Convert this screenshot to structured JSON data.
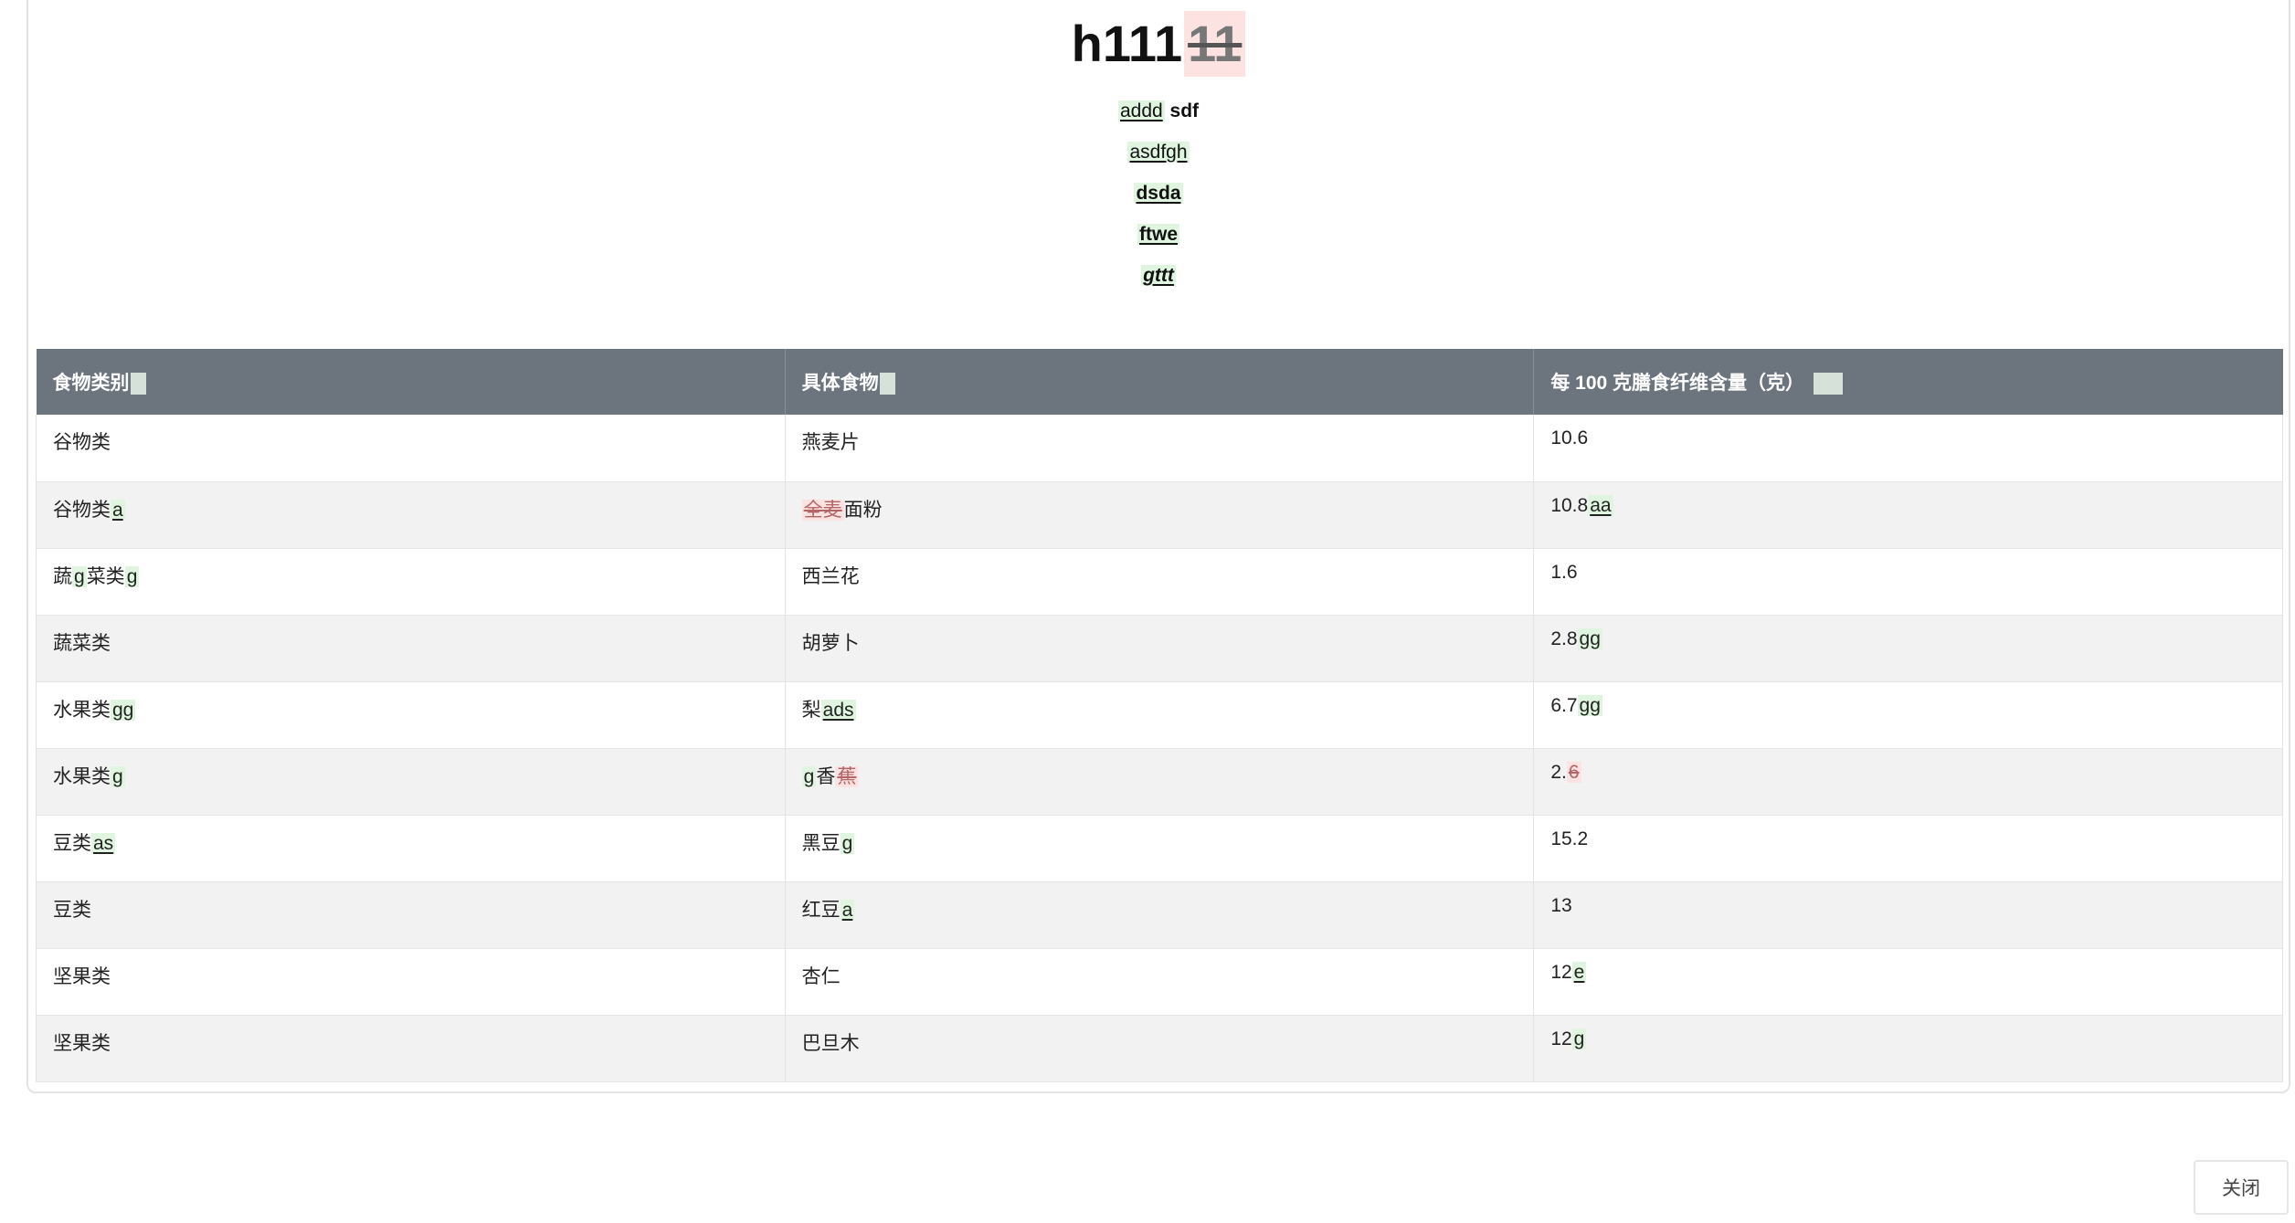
{
  "document": {
    "title": {
      "text": "h111",
      "deleted": "11"
    },
    "lines": [
      [
        {
          "text": "addd",
          "style": "ins"
        },
        {
          "text": " "
        },
        {
          "text": "sdf",
          "style": "bold"
        }
      ],
      [
        {
          "text": "asdfgh",
          "style": "ins"
        }
      ],
      [
        {
          "text": "dsda",
          "style": "ins-bold"
        }
      ],
      [
        {
          "text": "ftwe",
          "style": "ins-bold"
        }
      ],
      [
        {
          "text": "gttt",
          "style": "ins-bold-italic"
        }
      ]
    ]
  },
  "table": {
    "headers": [
      {
        "label": "食物类别",
        "marker": "ins"
      },
      {
        "label": "具体食物",
        "marker": "ins"
      },
      {
        "label": "每 100 克膳食纤维含量（克）",
        "marker": "ins-wide"
      }
    ],
    "rows": [
      [
        [
          {
            "text": "谷物类"
          }
        ],
        [
          {
            "text": "燕麦片"
          }
        ],
        [
          {
            "text": "10.6"
          }
        ]
      ],
      [
        [
          {
            "text": "谷物类"
          },
          {
            "text": "a",
            "style": "ins"
          }
        ],
        [
          {
            "text": "全麦",
            "style": "del"
          },
          {
            "text": "面粉"
          }
        ],
        [
          {
            "text": "10.8"
          },
          {
            "text": "aa",
            "style": "ins"
          }
        ]
      ],
      [
        [
          {
            "text": "蔬"
          },
          {
            "text": "g",
            "style": "ins-plain"
          },
          {
            "text": "菜类"
          },
          {
            "text": "g",
            "style": "ins-plain"
          }
        ],
        [
          {
            "text": "西兰花"
          }
        ],
        [
          {
            "text": "1.6"
          }
        ]
      ],
      [
        [
          {
            "text": "蔬菜类"
          }
        ],
        [
          {
            "text": "胡萝卜"
          }
        ],
        [
          {
            "text": "2.8"
          },
          {
            "text": "gg",
            "style": "ins-plain"
          }
        ]
      ],
      [
        [
          {
            "text": "水果类"
          },
          {
            "text": "gg",
            "style": "ins-plain"
          }
        ],
        [
          {
            "text": "梨"
          },
          {
            "text": "ads",
            "style": "ins"
          }
        ],
        [
          {
            "text": "6.7"
          },
          {
            "text": "gg",
            "style": "ins-plain"
          }
        ]
      ],
      [
        [
          {
            "text": "水果类"
          },
          {
            "text": "g",
            "style": "ins-plain"
          }
        ],
        [
          {
            "text": "g",
            "style": "ins-plain"
          },
          {
            "text": "香"
          },
          {
            "text": "蕉",
            "style": "del"
          }
        ],
        [
          {
            "text": "2."
          },
          {
            "text": "6",
            "style": "del"
          }
        ]
      ],
      [
        [
          {
            "text": "豆类"
          },
          {
            "text": "as",
            "style": "ins"
          }
        ],
        [
          {
            "text": "黑豆"
          },
          {
            "text": "g",
            "style": "ins-plain"
          }
        ],
        [
          {
            "text": "15.2"
          }
        ]
      ],
      [
        [
          {
            "text": "豆类"
          }
        ],
        [
          {
            "text": "红豆"
          },
          {
            "text": "a",
            "style": "ins"
          }
        ],
        [
          {
            "text": "13"
          }
        ]
      ],
      [
        [
          {
            "text": "坚果类"
          }
        ],
        [
          {
            "text": "杏仁"
          }
        ],
        [
          {
            "text": "12"
          },
          {
            "text": "e",
            "style": "ins"
          }
        ]
      ],
      [
        [
          {
            "text": "坚果类"
          }
        ],
        [
          {
            "text": "巴旦木"
          }
        ],
        [
          {
            "text": "12"
          },
          {
            "text": "g",
            "style": "ins-plain"
          }
        ]
      ]
    ]
  },
  "footer": {
    "close_label": "关闭"
  }
}
